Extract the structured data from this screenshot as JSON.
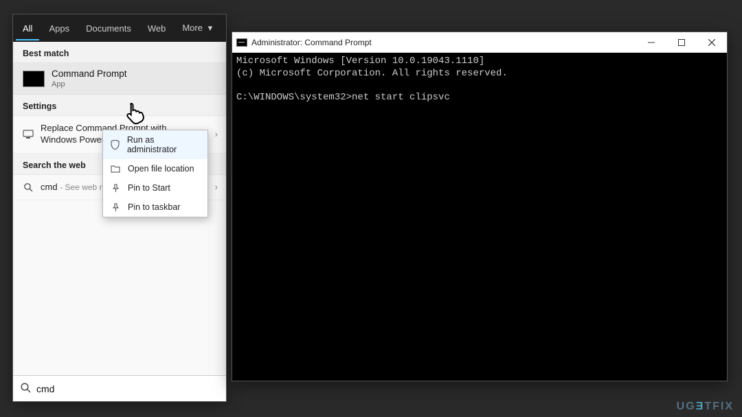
{
  "search": {
    "tabs": [
      "All",
      "Apps",
      "Documents",
      "Web",
      "More"
    ],
    "active_tab": 0,
    "best_match_header": "Best match",
    "best_match": {
      "title": "Command Prompt",
      "subtitle": "App"
    },
    "settings_header": "Settings",
    "settings_item": "Replace Command Prompt with Windows PowerShell",
    "web_header": "Search the web",
    "web_item_query": "cmd",
    "web_item_suffix": "See web results",
    "input_value": "cmd",
    "context_menu": [
      {
        "icon": "shield-icon",
        "label": "Run as administrator"
      },
      {
        "icon": "folder-icon",
        "label": "Open file location"
      },
      {
        "icon": "pin-start-icon",
        "label": "Pin to Start"
      },
      {
        "icon": "pin-taskbar-icon",
        "label": "Pin to taskbar"
      }
    ]
  },
  "cmd_window": {
    "title": "Administrator: Command Prompt",
    "lines": [
      "Microsoft Windows [Version 10.0.19043.1110]",
      "(c) Microsoft Corporation. All rights reserved.",
      "",
      "C:\\WINDOWS\\system32>net start clipsvc"
    ]
  },
  "watermark": "UGETFIX"
}
